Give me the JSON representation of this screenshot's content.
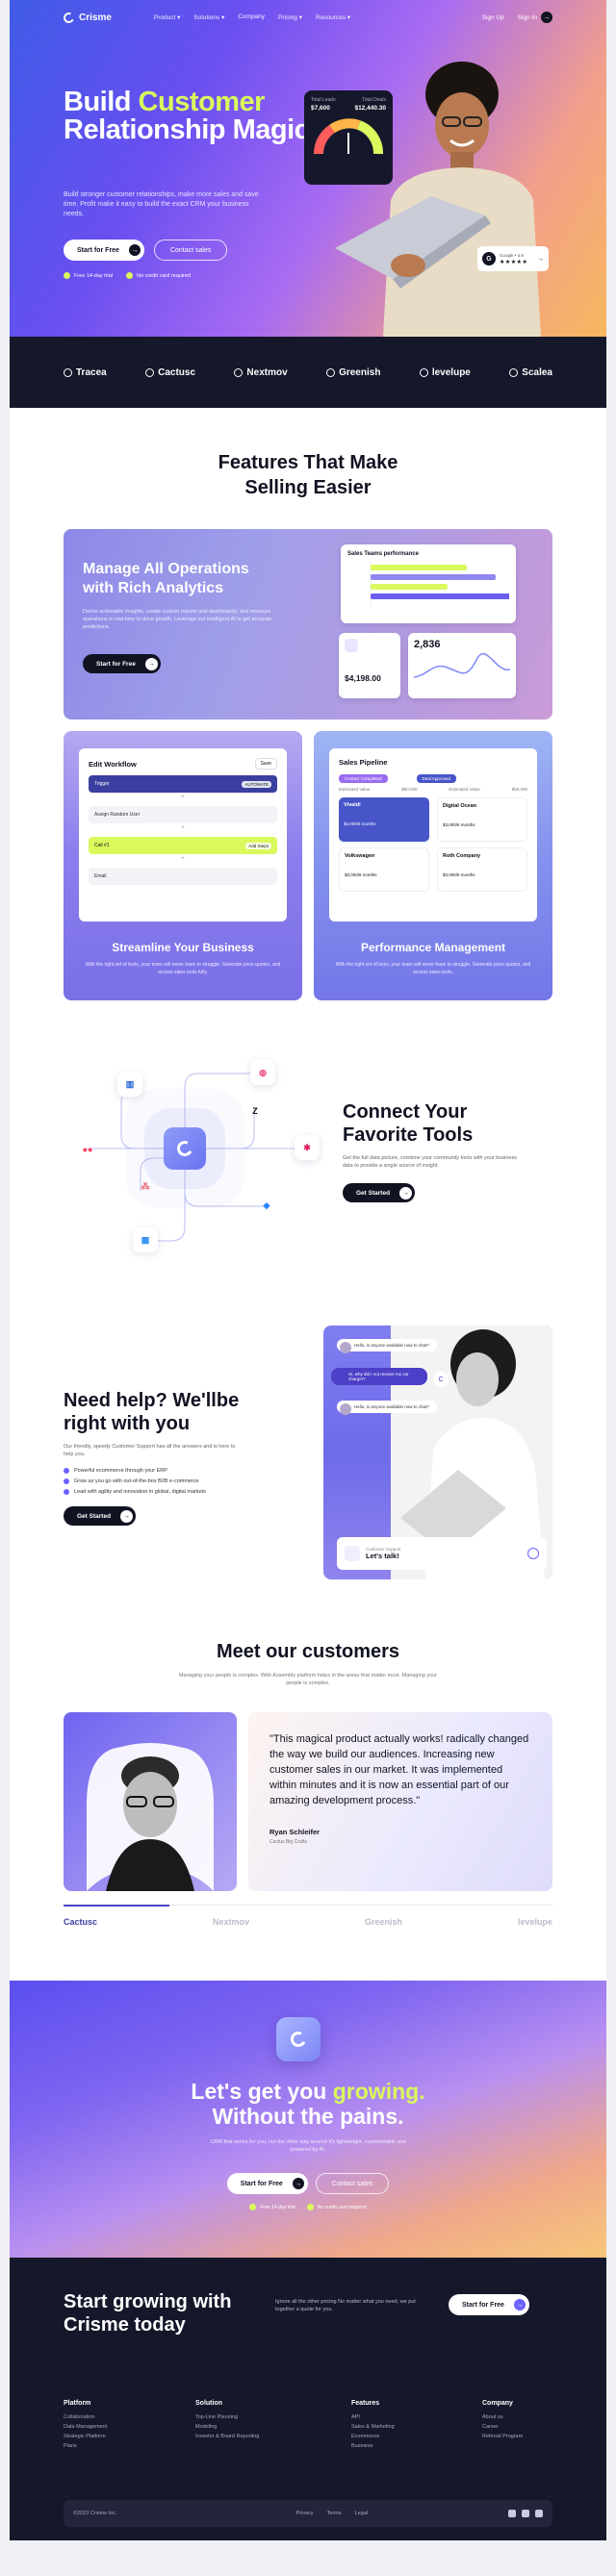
{
  "brand": {
    "name": "Crisme"
  },
  "nav": {
    "items": [
      "Product",
      "Solutions",
      "Company",
      "Pricing",
      "Resources"
    ],
    "signup": "Sign Up",
    "signin": "Sign In"
  },
  "hero": {
    "title_1": "Build ",
    "title_accent": "Customer",
    "title_2": "Relationship Magic",
    "subtitle": "Build stronger customer relationships, make more sales and save time. Profit make it easy to build the exact CRM your business needs.",
    "cta_primary": "Start for Free",
    "cta_secondary": "Contact sales",
    "check_1": "Free 14-day trial",
    "check_2": "No credit card required",
    "gauge": {
      "label_left": "Total Leads",
      "label_right": "Total Deals",
      "value_left": "$7,600",
      "value_right": "$12,440.30"
    },
    "rating": {
      "label": "Google • 4.9",
      "stars": "★★★★★"
    }
  },
  "partners": [
    "Tracea",
    "Cactusc",
    "Nextmov",
    "Greenish",
    "levelupe",
    "Scalea"
  ],
  "features": {
    "title": "Features That Make Selling Easier",
    "big": {
      "title": "Manage All Operations with Rich Analytics",
      "desc": "Derive actionable insights, create custom reports and dashboards, and measure operations in real-time to drive growth. Leverage our intelligent AI to get accurate predictions.",
      "cta": "Start for Free",
      "chart_title": "Sales Teams performance",
      "stat_value": "2,836",
      "stat_money": "$4,198.00"
    },
    "left": {
      "panel_title": "Edit Workflow",
      "save": "Save",
      "rows": [
        "Trigger",
        "Assign Random User",
        "Call #1",
        "Email"
      ],
      "tag_1": "AUTOMATE",
      "tag_2": "Add Steps",
      "title": "Streamline Your Business",
      "desc": "With the right set of tools, your team will never have to struggle. Generate price quotes, and access sales tools fully."
    },
    "right": {
      "panel_title": "Sales Pipeline",
      "tag_1": "Contact Completed",
      "tag_2": "Deal Approved",
      "deal_label": "Estimated Value",
      "deal_value": "$50,000",
      "cards": [
        "Vivaldi",
        "Digital Ocean",
        "Volkswagen",
        "Roth Company"
      ],
      "card_sub": "$3,000/6 months",
      "title": "Performance Management",
      "desc": "With the right set of tools, your team will never have to struggle. Generate price quotes, and access sales tools."
    }
  },
  "tools": {
    "title": "Connect Your Favorite Tools",
    "desc": "Get the full data picture, combine your community tools with your business data to provide a single source of insight.",
    "cta": "Get Started"
  },
  "help": {
    "title": "Need help? We'llbe right with you",
    "desc": "Our friendly, speedy Customer Support has all the answers and is here to help you.",
    "items": [
      "Powerful ecommerce through your ERP",
      "Grow as you go with out-of-the-box B2B e-commerce",
      "Lead with agility and innovation in global, digital markets"
    ],
    "cta": "Get Started",
    "bubble_1": "Hello, is anyone available now to chat?",
    "bubble_2": "Hi, why did I not receive my car charger?",
    "bubble_3": "Hello, is anyone available now to chat?",
    "support_label": "Customer Support",
    "support_cta": "Let's talk!"
  },
  "customers": {
    "title": "Meet our customers",
    "subtitle": "Managing your people is complex. With Assembly platform helps in the areas that matter most. Managing your people is complex.",
    "quote": "\"This magical product actually works! radically changed the way we build our audiences. Increasing new customer sales in our market. It was implemented within minutes and  it is now an essential part of our amazing  development process.\"",
    "name": "Ryan Schleifer",
    "role": "Cactus Big Crafts",
    "logos": [
      "Cactusc",
      "Nextmov",
      "Greenish",
      "levelupe"
    ]
  },
  "cta": {
    "title_1": "Let's get you ",
    "title_accent": "growing.",
    "title_2": "Without the pains.",
    "desc": "CRM that works for you, not the other way around It's lightweight, customizable and powered by AI.",
    "primary": "Start for Free",
    "secondary": "Contact sales",
    "check_1": "Free 14-day trial",
    "check_2": "No credit card required"
  },
  "footer": {
    "title": "Start growing with Crisme today",
    "blurb": "Ignore all the other pricing No matter what you need, we put together a quote for you.",
    "cta": "Start for Free",
    "columns": [
      {
        "title": "Platform",
        "links": [
          "Collaboration",
          "Data Management",
          "Strategic Platform",
          "Plans"
        ]
      },
      {
        "title": "Solution",
        "links": [
          "Top-Line Planning",
          "Modeling",
          "Investor & Board Reporting"
        ]
      },
      {
        "title": "Features",
        "links": [
          "API",
          "Sales & Marketing",
          "Ecommerce",
          "Business"
        ]
      },
      {
        "title": "Company",
        "links": [
          "About us",
          "Career",
          "Referral Program"
        ]
      }
    ],
    "copyright": "©2023 Crisme Inc.",
    "legal": [
      "Privacy",
      "Terms",
      "Legal"
    ]
  }
}
